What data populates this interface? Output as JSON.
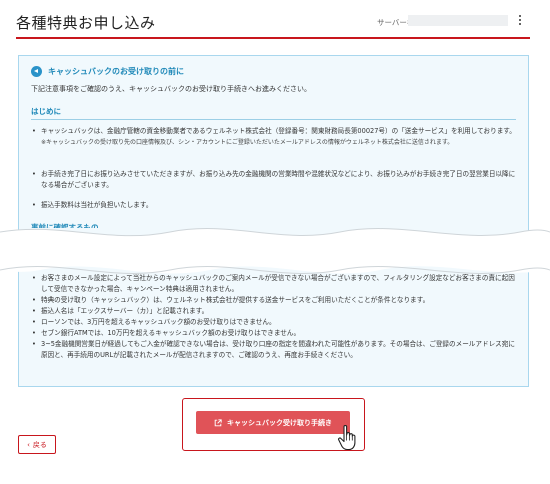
{
  "header": {
    "title": "各種特典お申し込み",
    "server_label": "サーバー名",
    "menu_icon": "kebab-menu-icon"
  },
  "notice": {
    "icon": "megaphone-icon",
    "title": "キャッシュバックのお受け取りの前に",
    "intro": "下記注意事項をご確認のうえ、キャッシュバックのお受け取り手続きへお進みください。",
    "section1_title": "はじめに",
    "section1_items": [
      {
        "text": "キャッシュバックは、金融庁管轄の資金移動業者であるウェルネット株式会社（登録番号：関東財務局長第00027号）の「送金サービス」を利用しております。",
        "note": "※キャッシュバックの受け取り先の口座情報及び、シン・アカウントにご登録いただいたメールアドレスの情報がウェルネット株式会社に送信されます。"
      },
      {
        "text": "お手続き完了日にお振り込みさせていただきますが、お振り込み先の金融機関の営業時間や混雑状況などにより、お振り込みがお手続き完了日の翌営業日以降になる場合がございます。"
      },
      {
        "text": "振込手数料は当社が負担いたします。"
      }
    ],
    "section2_title_partial": "事前に確認するもの",
    "section3_items": [
      {
        "text": "お客さまのメール設定によって当社からのキャッシュバックのご案内メールが受信できない場合がございますので、フィルタリング設定などお客さまの責に起因して受信できなかった場合、キャンペーン特典は適用されません。"
      },
      {
        "text": "特典の受け取り（キャッシュバック）は、ウェルネット株式会社が提供する送金サービスをご利用いただくことが条件となります。"
      },
      {
        "text": "振込人名は「エックスサーバー（カ）」と記載されます。"
      },
      {
        "text": "ローソンでは、3万円を超えるキャッシュバック額のお受け取りはできません。"
      },
      {
        "text": "セブン銀行ATMでは、10万円を超えるキャッシュバック額のお受け取りはできません。"
      },
      {
        "text": "3~5金融機関営業日が経過してもご入金が確認できない場合は、受け取り口座の指定を間違われた可能性があります。その場合は、ご登録のメールアドレス宛に原因と、再手続用のURLが記載されたメールが配信されますので、ご確認のうえ、再度お手続きください。"
      }
    ]
  },
  "cta": {
    "label": "キャッシュバック受け取り手続き",
    "icon": "external-link-icon",
    "color": "#e05358",
    "highlight_color": "#c8161d"
  },
  "back": {
    "label": "戻る",
    "icon": "chevron-left-icon"
  },
  "colors": {
    "accent": "#c8161d",
    "info_blue": "#1e88b8",
    "notice_bg": "#f1f9fd"
  }
}
